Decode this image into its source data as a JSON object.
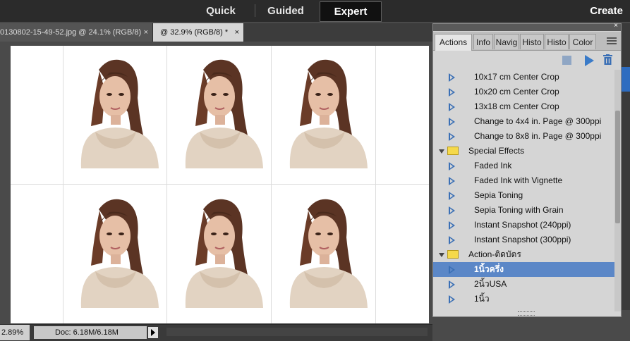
{
  "modes": {
    "quick": "Quick",
    "guided": "Guided",
    "expert": "Expert",
    "create": "Create"
  },
  "doc_tabs": [
    {
      "label": "0130802-15-49-52.jpg @ 24.1% (RGB/8)",
      "close": "×"
    },
    {
      "label": "@ 32.9% (RGB/8) *",
      "close": "×"
    }
  ],
  "status": {
    "zoom": "2.89%",
    "doc": "Doc: 6.18M/6.18M"
  },
  "panel": {
    "close": "×",
    "tabs": [
      "Actions",
      "Info",
      "Navig",
      "Histo",
      "Histo",
      "Color"
    ],
    "actions": [
      {
        "type": "action",
        "label": "10x17 cm Center Crop"
      },
      {
        "type": "action",
        "label": "10x20 cm Center Crop"
      },
      {
        "type": "action",
        "label": "13x18 cm Center Crop"
      },
      {
        "type": "action",
        "label": "Change to 4x4 in. Page @ 300ppi"
      },
      {
        "type": "action",
        "label": "Change to 8x8 in. Page @ 300ppi"
      },
      {
        "type": "folder",
        "label": "Special Effects"
      },
      {
        "type": "action",
        "label": "Faded Ink"
      },
      {
        "type": "action",
        "label": "Faded Ink with Vignette"
      },
      {
        "type": "action",
        "label": "Sepia Toning"
      },
      {
        "type": "action",
        "label": "Sepia Toning with Grain"
      },
      {
        "type": "action",
        "label": "Instant Snapshot (240ppi)"
      },
      {
        "type": "action",
        "label": "Instant Snapshot (300ppi)"
      },
      {
        "type": "folder",
        "label": "Action-ติดบัตร"
      },
      {
        "type": "action",
        "label": "1นิ้วครึ่ง",
        "selected": true
      },
      {
        "type": "action",
        "label": "2นิ้วUSA"
      },
      {
        "type": "action",
        "label": "1นิ้ว"
      }
    ]
  }
}
